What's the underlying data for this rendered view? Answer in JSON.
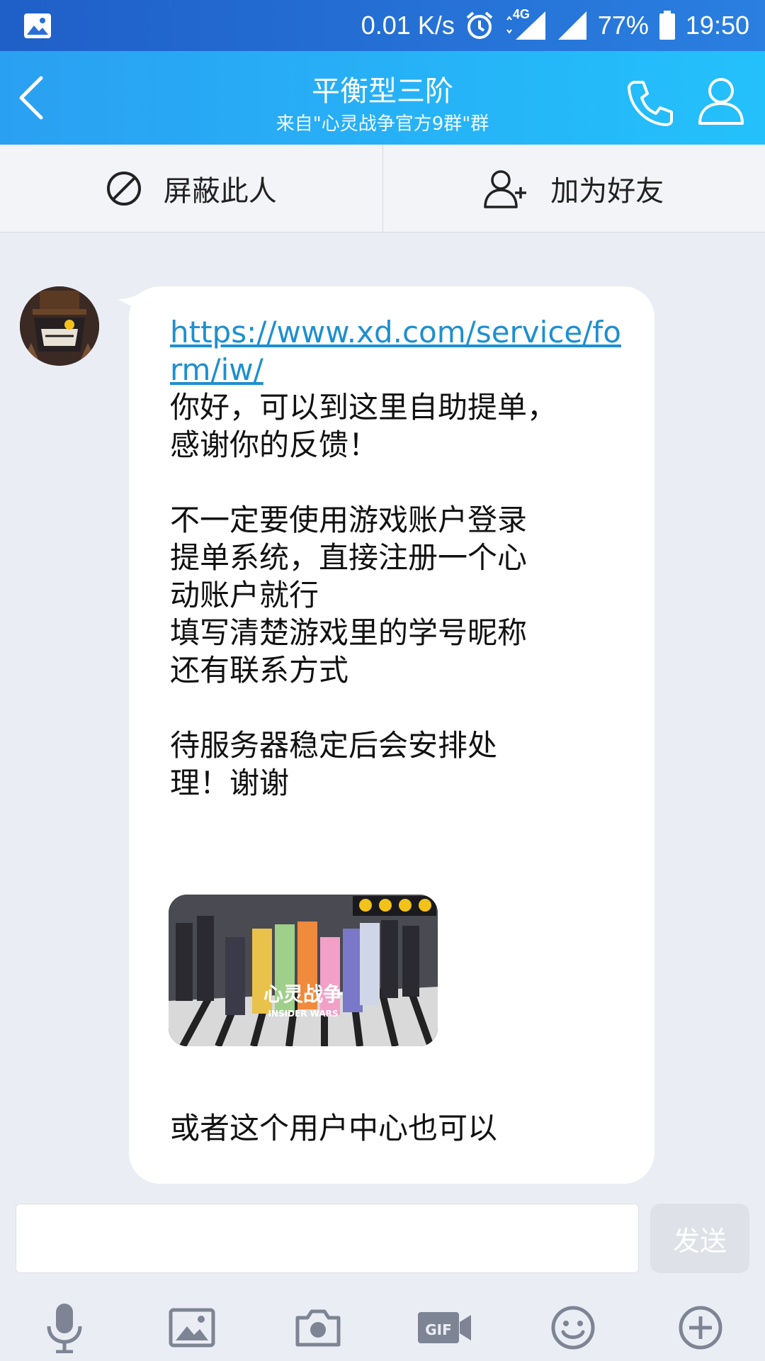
{
  "status_bar": {
    "network_speed": "0.01 K/s",
    "network_type": "4G",
    "battery": "77%",
    "time": "19:50"
  },
  "header": {
    "title": "平衡型三阶",
    "subtitle": "来自\"心灵战争官方9群\"群"
  },
  "actions": {
    "block_label": "屏蔽此人",
    "add_friend_label": "加为好友"
  },
  "message": {
    "link": "https://www.xd.com/service/form/iw/",
    "lines": [
      "你好，可以到这里自助提单，",
      "感谢你的反馈！",
      "",
      "不一定要使用游戏账户登录",
      "提单系统，直接注册一个心",
      "动账户就行",
      "填写清楚游戏里的学号昵称",
      "还有联系方式",
      "",
      "待服务器稳定后会安排处",
      "理！谢谢"
    ],
    "image_text": "心灵战争",
    "image_subtext": "INSIDER WARS",
    "last_line": "或者这个用户中心也可以"
  },
  "input": {
    "placeholder": "",
    "send_label": "发送"
  },
  "colors": {
    "header_start": "#2aa0f2",
    "header_end": "#23c1fb",
    "link": "#1e8fcf",
    "icon_gray": "#7d8595"
  },
  "toolbar_icons": [
    "microphone-icon",
    "image-icon",
    "camera-icon",
    "gif-icon",
    "emoji-icon",
    "plus-icon"
  ]
}
